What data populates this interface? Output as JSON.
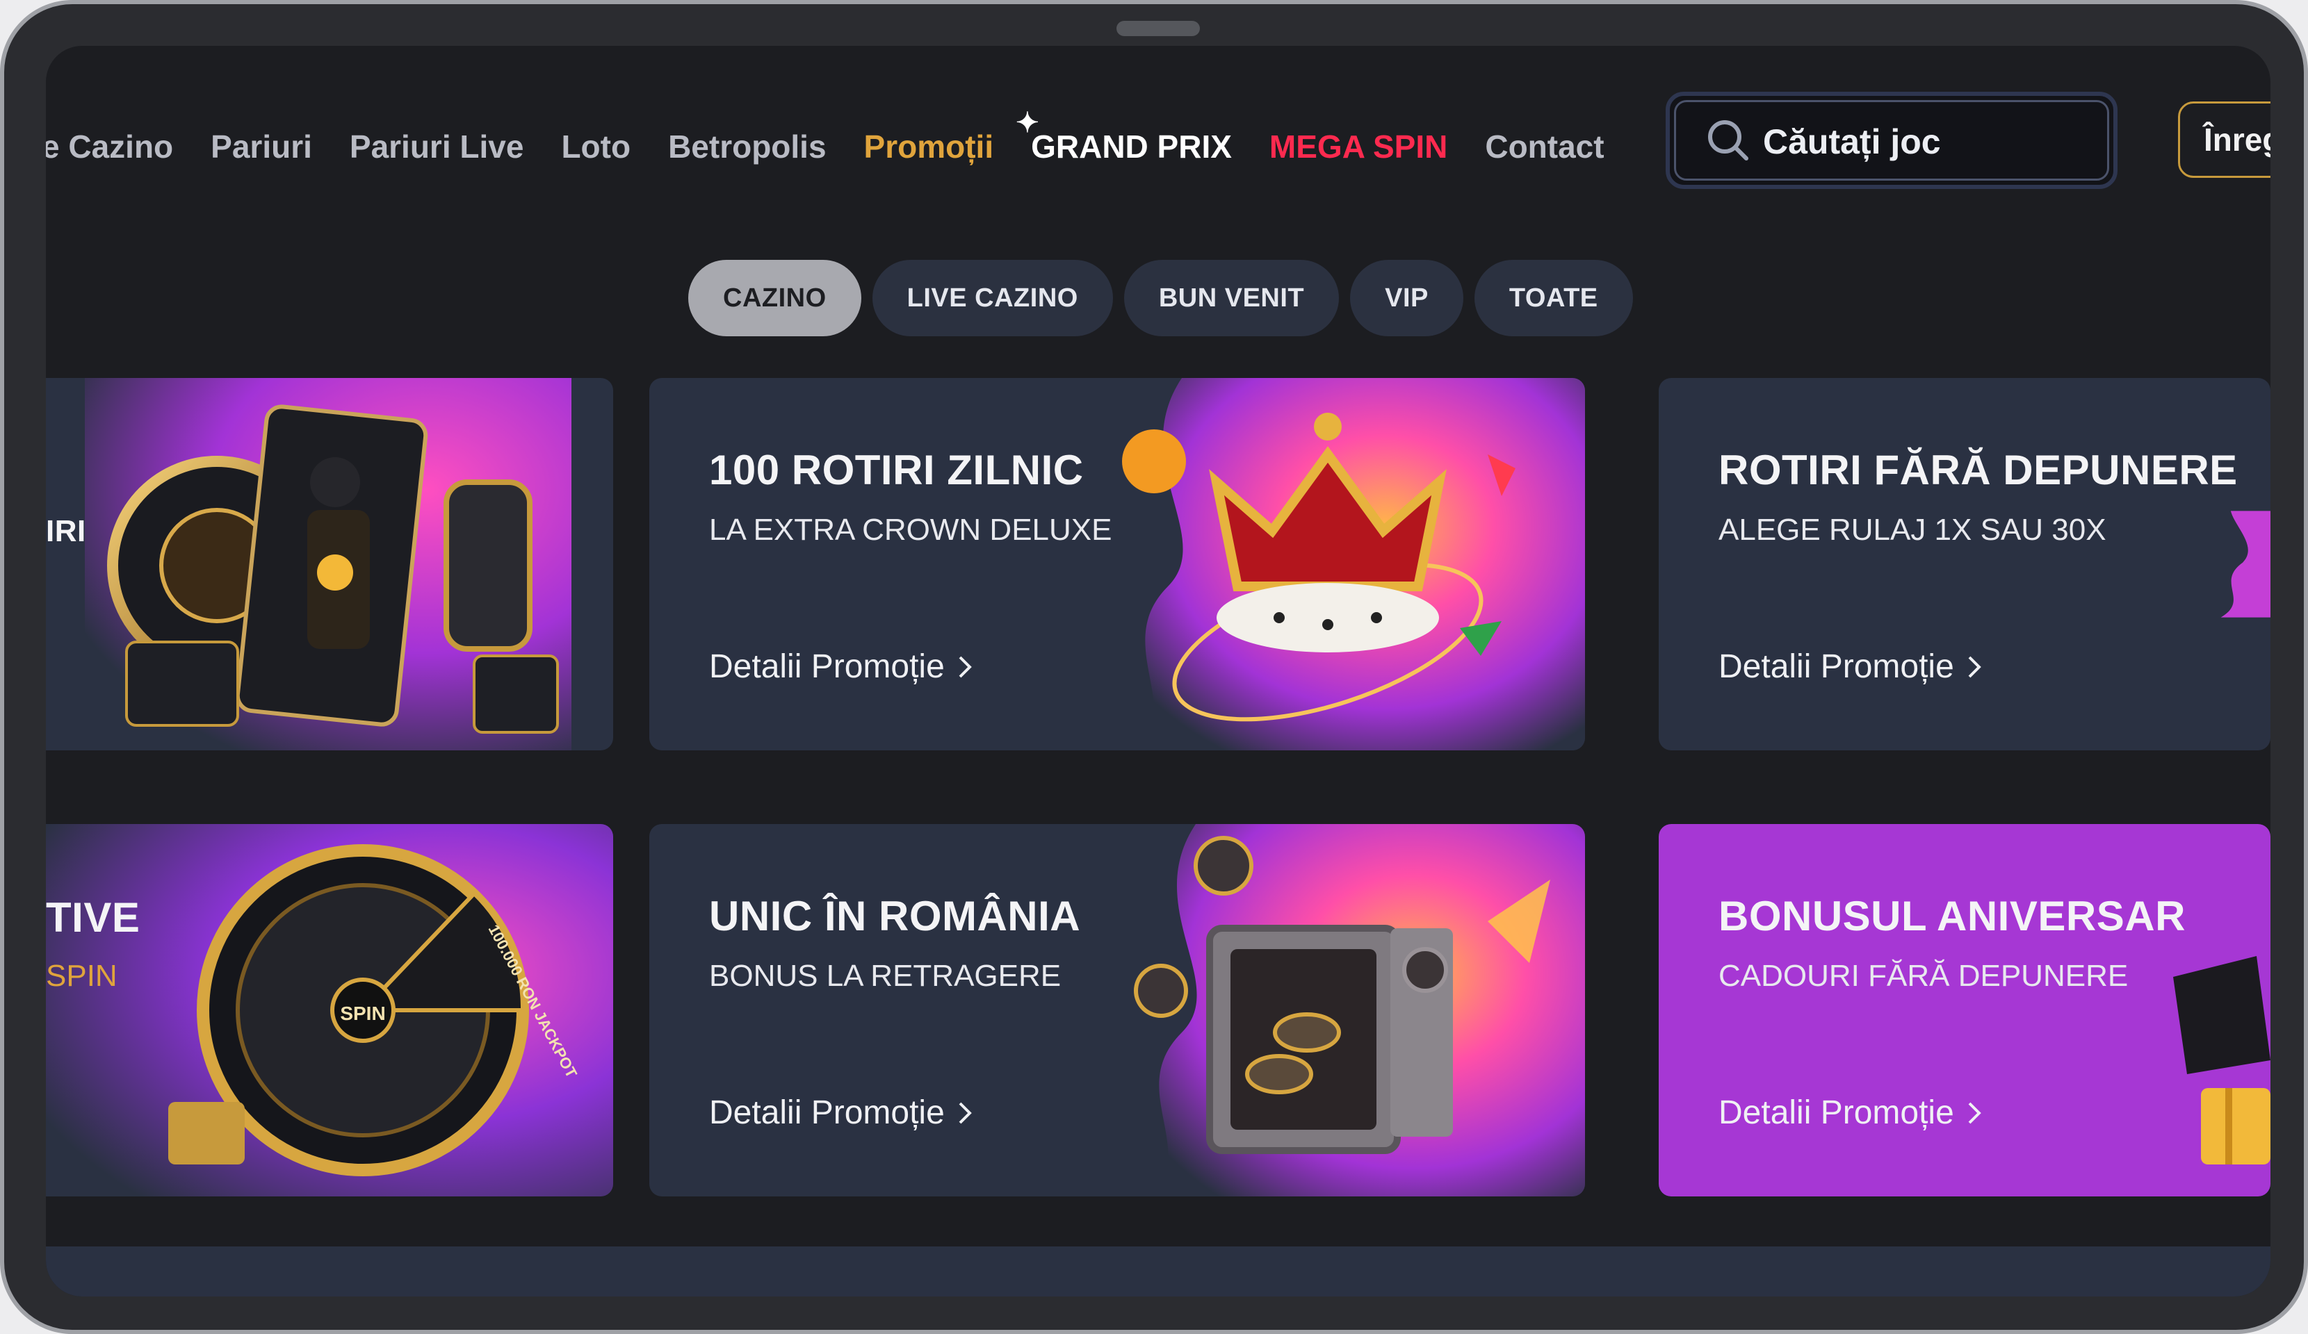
{
  "nav": {
    "items": [
      {
        "label": "e Cazino",
        "color": "#b9bbc4"
      },
      {
        "label": "Pariuri",
        "color": "#b9bbc4"
      },
      {
        "label": "Pariuri Live",
        "color": "#b9bbc4"
      },
      {
        "label": "Loto",
        "color": "#b9bbc4"
      },
      {
        "label": "Betropolis",
        "color": "#b9bbc4"
      },
      {
        "label": "Promoții",
        "color": "#e0a43c"
      },
      {
        "label": "GRAND PRIX",
        "color": "#ffffff"
      },
      {
        "label": "MEGA SPIN",
        "color": "#ff2a4f"
      },
      {
        "label": "Contact",
        "color": "#b9bbc4"
      }
    ]
  },
  "search": {
    "placeholder": "Căutați joc"
  },
  "header": {
    "register_label": "Înreg"
  },
  "tabs": [
    {
      "label": "CAZINO",
      "active": true
    },
    {
      "label": "LIVE CAZINO",
      "active": false
    },
    {
      "label": "BUN VENIT",
      "active": false
    },
    {
      "label": "VIP",
      "active": false
    },
    {
      "label": "TOATE",
      "active": false
    }
  ],
  "promos": {
    "left_top": {
      "title": "IRI"
    },
    "left_bottom": {
      "title": "TIVE",
      "sub": "SPIN"
    },
    "cards": [
      {
        "title": "100 ROTIRI ZILNIC",
        "sub": "LA EXTRA CROWN DELUXE",
        "link": "Detalii Promoție"
      },
      {
        "title": "ROTIRI FĂRĂ DEPUNERE",
        "sub": "ALEGE RULAJ 1X SAU 30X",
        "link": "Detalii Promoție"
      },
      {
        "title": "UNIC ÎN ROMÂNIA",
        "sub": "BONUS LA RETRAGERE",
        "link": "Detalii Promoție"
      },
      {
        "title": "BONUSUL ANIVERSAR",
        "sub": "CADOURI FĂRĂ DEPUNERE",
        "link": "Detalii Promoție"
      }
    ],
    "spin_wheel": {
      "center": "SPIN",
      "jackpot": "100.000 RON JACKPOT"
    }
  }
}
